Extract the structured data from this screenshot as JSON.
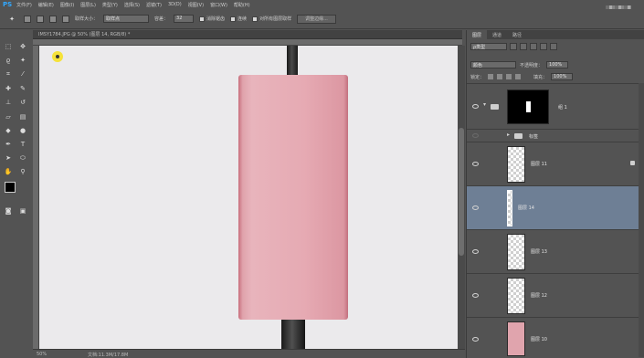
{
  "app": {
    "logo": "PS"
  },
  "menu": [
    "文件(F)",
    "编辑(E)",
    "图像(I)",
    "图层(L)",
    "类型(Y)",
    "选择(S)",
    "滤镜(T)",
    "3D(D)",
    "视图(V)",
    "窗口(W)",
    "帮助(H)"
  ],
  "options": {
    "sample_size_label": "取样大小：",
    "sample_size_value": "取样点",
    "tolerance_label": "容差：",
    "tolerance_value": "32",
    "antialias_label": "消除锯齿",
    "contiguous_label": "连续",
    "sample_all_label": "对所有图层取样",
    "refine_button": "调整边缘..."
  },
  "document": {
    "tab_title": "IMSY1784.JPG @ 50% (图层 14, RGB/8) *"
  },
  "panel": {
    "tabs": [
      "图层",
      "通道",
      "路径"
    ],
    "filter_label": "ρ类型",
    "blend_mode": "颜色",
    "opacity_label": "不透明度：",
    "opacity_value": "100%",
    "lock_label": "锁定：",
    "fill_label": "填充：",
    "fill_value": "100%"
  },
  "layers": [
    {
      "name": "组 1",
      "type": "group"
    },
    {
      "name": "标签",
      "type": "group"
    },
    {
      "name": "图层 11",
      "type": "layer",
      "locked": true
    },
    {
      "name": "图层 14",
      "type": "layer",
      "selected": true
    },
    {
      "name": "图层 13",
      "type": "layer"
    },
    {
      "name": "图层 12",
      "type": "layer"
    },
    {
      "name": "图层 10",
      "type": "layer"
    }
  ],
  "status": {
    "zoom": "50%",
    "doc_info": "文档:11.3M/17.8M"
  },
  "colors": {
    "accent": "#31a8ff",
    "selected_layer": "#6e7f95",
    "pink": "#e6aab3"
  }
}
